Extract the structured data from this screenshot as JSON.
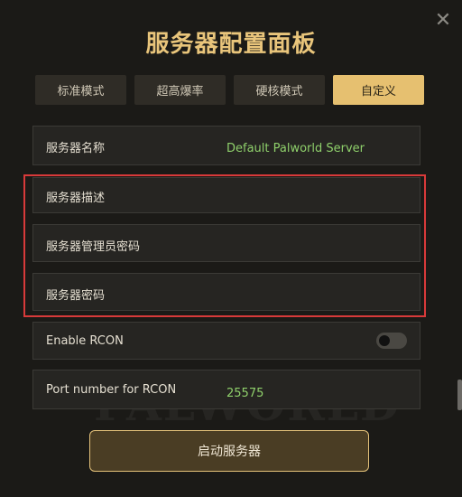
{
  "panel": {
    "title": "服务器配置面板",
    "close_glyph": "✕",
    "watermark": "PALWORLD"
  },
  "tabs": [
    {
      "label": "标准模式",
      "active": false
    },
    {
      "label": "超高爆率",
      "active": false
    },
    {
      "label": "硬核模式",
      "active": false
    },
    {
      "label": "自定义",
      "active": true
    }
  ],
  "settings": {
    "server_name": {
      "label": "服务器名称",
      "value": "Default Palworld Server"
    },
    "server_description": {
      "label": "服务器描述",
      "value": ""
    },
    "admin_password": {
      "label": "服务器管理员密码",
      "value": ""
    },
    "server_password": {
      "label": "服务器密码",
      "value": ""
    },
    "enable_rcon": {
      "label": "Enable RCON",
      "enabled": false
    },
    "rcon_port": {
      "label": "Port number for RCON",
      "value": "25575"
    }
  },
  "start_button": {
    "label": "启动服务器"
  },
  "colors": {
    "accent": "#e6c070",
    "title": "#e9c57b",
    "value_text": "#8fd06b",
    "highlight_border": "#d83a3a",
    "background": "#1b1a17"
  }
}
